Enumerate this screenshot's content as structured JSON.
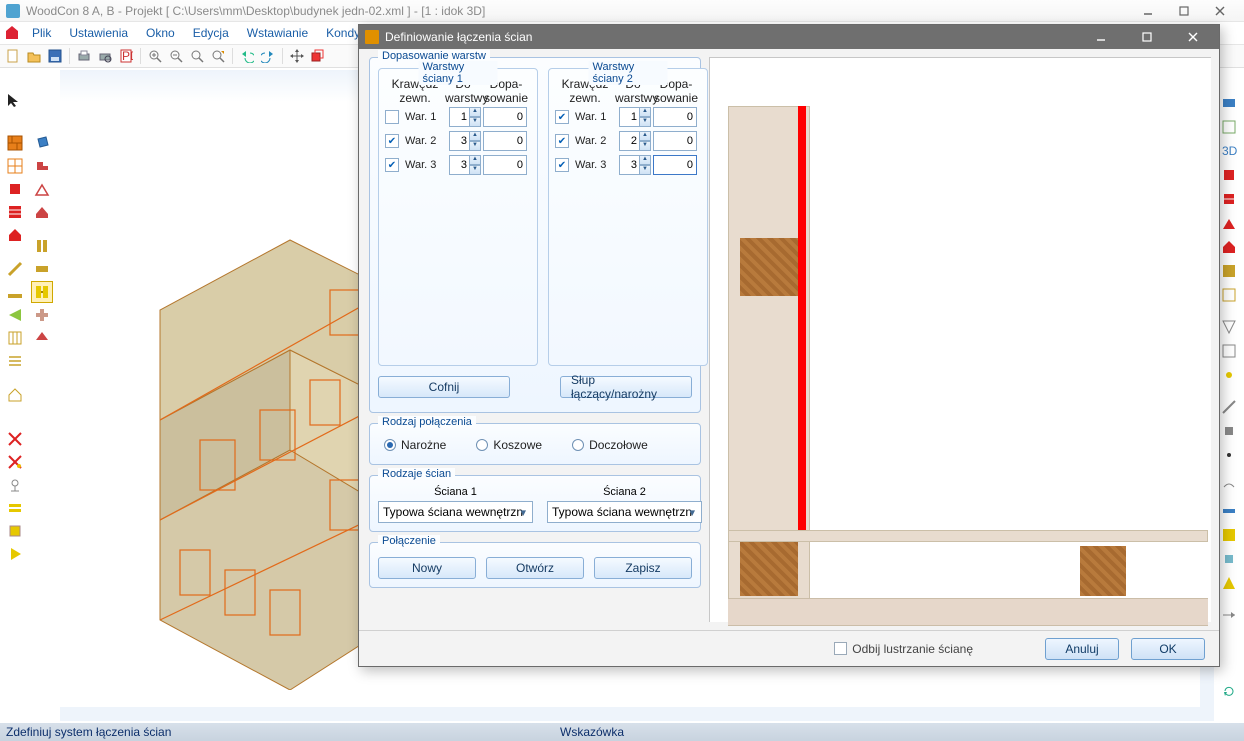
{
  "app": {
    "title": "WoodCon 8 A, B - Projekt [ C:\\Users\\mm\\Desktop\\budynek jedn-02.xml ]  - [1 : idok 3D]"
  },
  "menu": {
    "items": [
      "Plik",
      "Ustawienia",
      "Okno",
      "Edycja",
      "Wstawianie",
      "Kondygnacja"
    ]
  },
  "status": {
    "left": "Zdefiniuj system łączenia ścian",
    "center": "Wskazówka"
  },
  "dialog": {
    "title": "Definiowanie łączenia ścian",
    "group_fit": "Dopasowanie warstw",
    "wall1_title": "Warstwy ściany 1",
    "wall2_title": "Warstwy ściany 2",
    "hdr_edge": "Krawędź zewn.",
    "hdr_to": "Do warstwy",
    "hdr_fit": "Dopa-sowanie",
    "wall1": {
      "r1": {
        "label": "War. 1",
        "checked": false,
        "to": "1",
        "fit": "0"
      },
      "r2": {
        "label": "War. 2",
        "checked": true,
        "to": "3",
        "fit": "0"
      },
      "r3": {
        "label": "War. 3",
        "checked": true,
        "to": "3",
        "fit": "0"
      }
    },
    "wall2": {
      "r1": {
        "label": "War. 1",
        "checked": true,
        "to": "1",
        "fit": "0"
      },
      "r2": {
        "label": "War. 2",
        "checked": true,
        "to": "2",
        "fit": "0"
      },
      "r3": {
        "label": "War. 3",
        "checked": true,
        "to": "3",
        "fit": "0"
      }
    },
    "btn_undo": "Cofnij",
    "btn_corner": "Słup łączący/narożny",
    "group_conn_type": "Rodzaj połączenia",
    "radio_corner": "Narożne",
    "radio_basket": "Koszowe",
    "radio_butt": "Doczołowe",
    "group_wall_types": "Rodzaje ścian",
    "wall_label1": "Ściana 1",
    "wall_label2": "Ściana 2",
    "wall_sel1": "Typowa ściana wewnętrzn",
    "wall_sel2": "Typowa ściana wewnętrzn",
    "group_conn": "Połączenie",
    "btn_new": "Nowy",
    "btn_open": "Otwórz",
    "btn_save": "Zapisz",
    "chk_mirror": "Odbij lustrzanie ścianę",
    "btn_cancel": "Anuluj",
    "btn_ok": "OK"
  }
}
